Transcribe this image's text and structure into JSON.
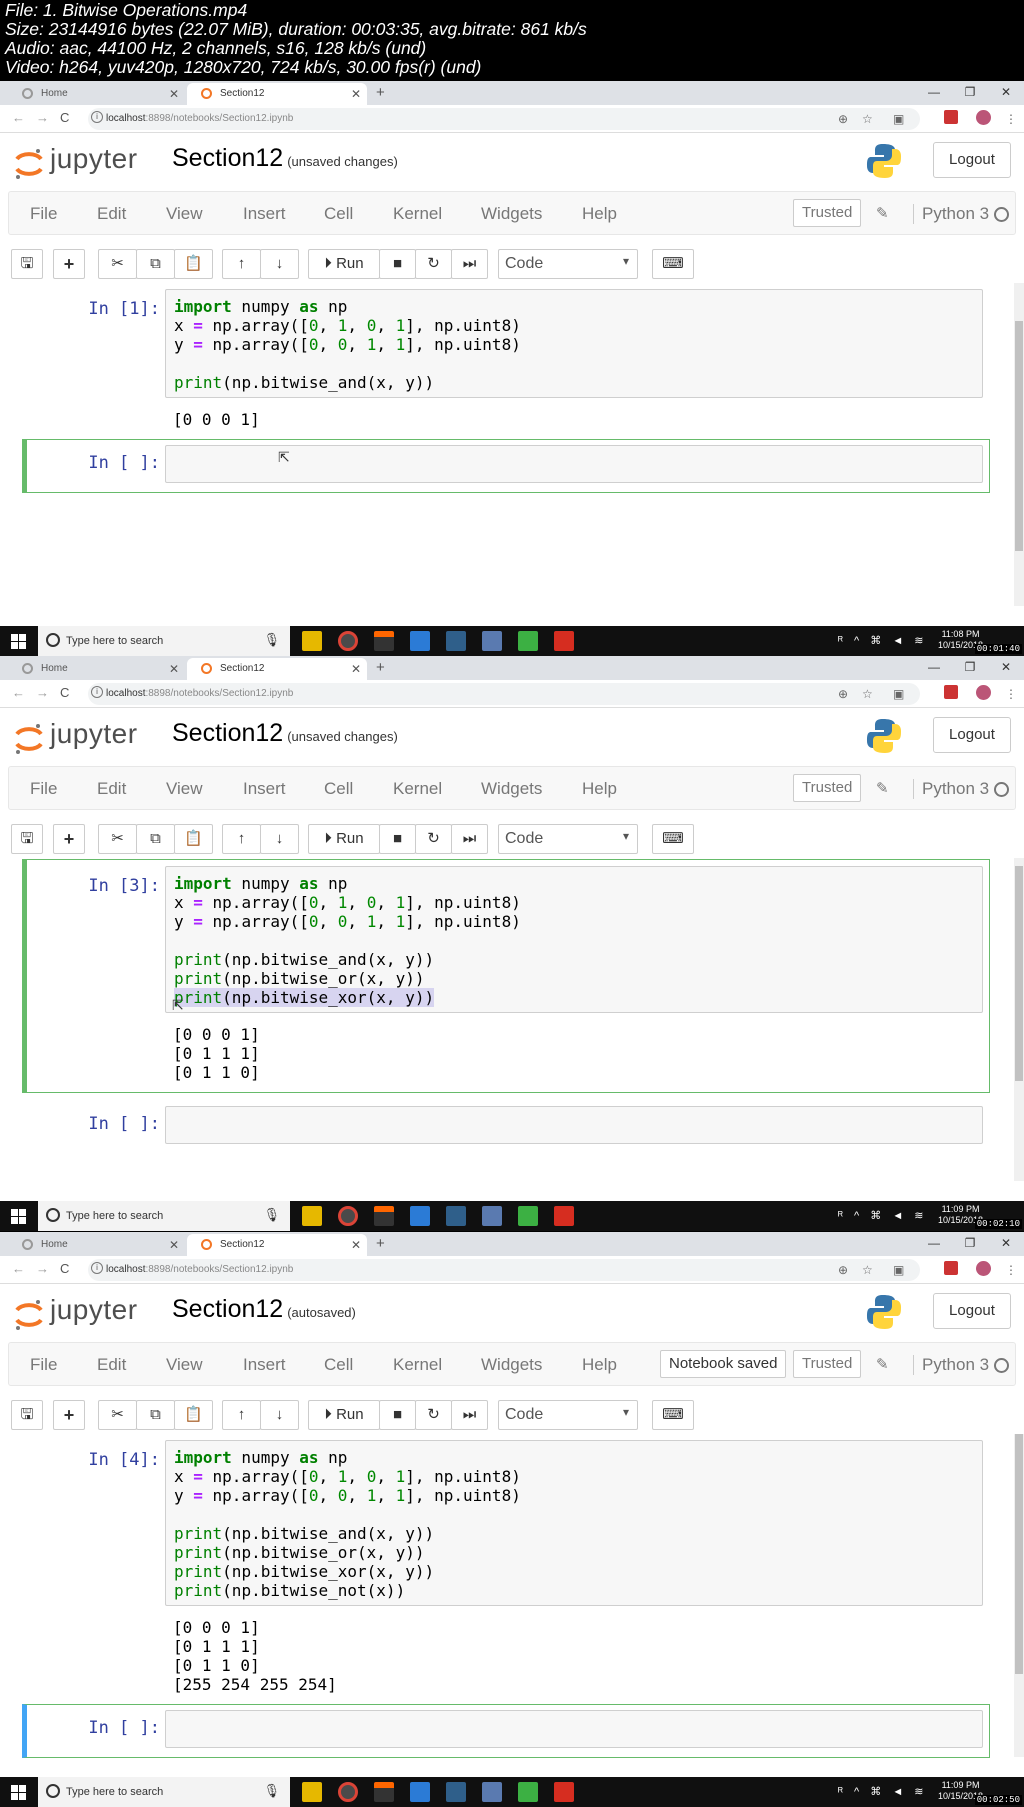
{
  "meta": {
    "line1": "File: 1. Bitwise Operations.mp4",
    "line2": "Size: 23144916 bytes (22.07 MiB), duration: 00:03:35, avg.bitrate: 861 kb/s",
    "line3": "Audio: aac, 44100 Hz, 2 channels, s16, 128 kb/s (und)",
    "line4": "Video: h264, yuv420p, 1280x720, 724 kb/s, 30.00 fps(r) (und)"
  },
  "browser": {
    "tab_home": "Home",
    "tab_active": "Section12",
    "url_host": "localhost",
    "url_rest": ":8898/notebooks/Section12.ipynb"
  },
  "jupyter": {
    "logo_text": "jupyter",
    "notebook_title": "Section12",
    "logout": "Logout",
    "menu": [
      "File",
      "Edit",
      "View",
      "Insert",
      "Cell",
      "Kernel",
      "Widgets",
      "Help"
    ],
    "trusted": "Trusted",
    "kernel": "Python 3",
    "run_label": "Run",
    "cell_type": "Code"
  },
  "taskbar": {
    "search_placeholder": "Type here to search"
  },
  "frames": [
    {
      "status": "(unsaved changes)",
      "prompt1": "In [1]:",
      "prompt2": "In [ ]:",
      "output": [
        "[0 0 0 1]"
      ],
      "clock_time": "11:08 PM",
      "clock_date": "10/15/2018",
      "timestamp": "00:01:40"
    },
    {
      "status": "(unsaved changes)",
      "prompt1": "In [3]:",
      "prompt2": "In [ ]:",
      "output": [
        "[0 0 0 1]",
        "[0 1 1 1]",
        "[0 1 1 0]"
      ],
      "clock_time": "11:09 PM",
      "clock_date": "10/15/2018",
      "timestamp": "00:02:10"
    },
    {
      "status": "(autosaved)",
      "notebook_saved": "Notebook saved",
      "prompt1": "In [4]:",
      "prompt2": "In [ ]:",
      "output": [
        "[0 0 0 1]",
        "[0 1 1 1]",
        "[0 1 1 0]",
        "[255 254 255 254]"
      ],
      "clock_time": "11:09 PM",
      "clock_date": "10/15/2018",
      "timestamp": "00:02:50"
    }
  ]
}
